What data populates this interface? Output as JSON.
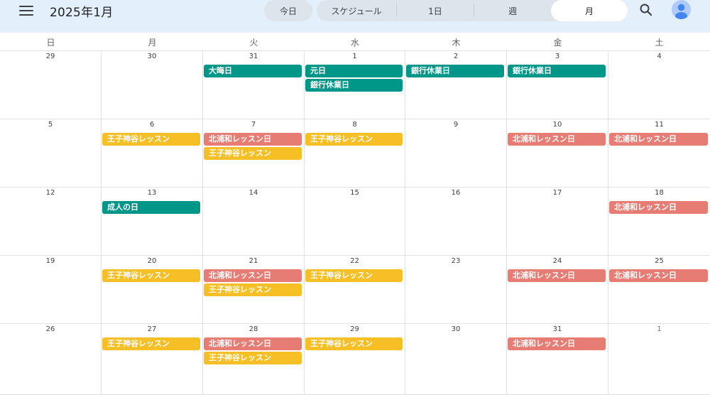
{
  "header": {
    "title": "2025年1月",
    "today_label": "今日",
    "views": [
      {
        "label": "スケジュール",
        "active": false
      },
      {
        "label": "1日",
        "active": false
      },
      {
        "label": "週",
        "active": false
      },
      {
        "label": "月",
        "active": true
      }
    ],
    "icons": {
      "menu": "hamburger-menu-icon",
      "search": "search-icon",
      "avatar": "account-avatar-icon"
    }
  },
  "weekdays": [
    "日",
    "月",
    "火",
    "水",
    "木",
    "金",
    "土"
  ],
  "colors": {
    "holiday": "#009688",
    "lesson_kamiya": "#f6bf26",
    "lesson_kitaurawa": "#e67c73",
    "topbar": "#e3effa"
  },
  "weeks": [
    [
      {
        "day": "29",
        "other": false,
        "events": []
      },
      {
        "day": "30",
        "other": false,
        "events": []
      },
      {
        "day": "31",
        "other": false,
        "events": [
          {
            "title": "大晦日",
            "type": "holiday"
          }
        ]
      },
      {
        "day": "1",
        "other": false,
        "events": [
          {
            "title": "元日",
            "type": "holiday"
          },
          {
            "title": "銀行休業日",
            "type": "holiday"
          }
        ]
      },
      {
        "day": "2",
        "other": false,
        "events": [
          {
            "title": "銀行休業日",
            "type": "holiday"
          }
        ]
      },
      {
        "day": "3",
        "other": false,
        "events": [
          {
            "title": "銀行休業日",
            "type": "holiday"
          }
        ]
      },
      {
        "day": "4",
        "other": false,
        "events": []
      }
    ],
    [
      {
        "day": "5",
        "other": false,
        "events": []
      },
      {
        "day": "6",
        "other": false,
        "events": [
          {
            "title": "王子神谷レッスン",
            "type": "lesson_kamiya"
          }
        ]
      },
      {
        "day": "7",
        "other": false,
        "events": [
          {
            "title": "北浦和レッスン日",
            "type": "lesson_kitaurawa"
          },
          {
            "title": "王子神谷レッスン",
            "type": "lesson_kamiya"
          }
        ]
      },
      {
        "day": "8",
        "other": false,
        "events": [
          {
            "title": "王子神谷レッスン",
            "type": "lesson_kamiya"
          }
        ]
      },
      {
        "day": "9",
        "other": false,
        "events": []
      },
      {
        "day": "10",
        "other": false,
        "events": [
          {
            "title": "北浦和レッスン日",
            "type": "lesson_kitaurawa"
          }
        ]
      },
      {
        "day": "11",
        "other": false,
        "events": [
          {
            "title": "北浦和レッスン日",
            "type": "lesson_kitaurawa"
          }
        ]
      }
    ],
    [
      {
        "day": "12",
        "other": false,
        "events": []
      },
      {
        "day": "13",
        "other": false,
        "events": [
          {
            "title": "成人の日",
            "type": "holiday"
          }
        ]
      },
      {
        "day": "14",
        "other": false,
        "events": []
      },
      {
        "day": "15",
        "other": false,
        "events": []
      },
      {
        "day": "16",
        "other": false,
        "events": []
      },
      {
        "day": "17",
        "other": false,
        "events": []
      },
      {
        "day": "18",
        "other": false,
        "events": [
          {
            "title": "北浦和レッスン日",
            "type": "lesson_kitaurawa"
          }
        ]
      }
    ],
    [
      {
        "day": "19",
        "other": false,
        "events": []
      },
      {
        "day": "20",
        "other": false,
        "events": [
          {
            "title": "王子神谷レッスン",
            "type": "lesson_kamiya"
          }
        ]
      },
      {
        "day": "21",
        "other": false,
        "events": [
          {
            "title": "北浦和レッスン日",
            "type": "lesson_kitaurawa"
          },
          {
            "title": "王子神谷レッスン",
            "type": "lesson_kamiya"
          }
        ]
      },
      {
        "day": "22",
        "other": false,
        "events": [
          {
            "title": "王子神谷レッスン",
            "type": "lesson_kamiya"
          }
        ]
      },
      {
        "day": "23",
        "other": false,
        "events": []
      },
      {
        "day": "24",
        "other": false,
        "events": [
          {
            "title": "北浦和レッスン日",
            "type": "lesson_kitaurawa"
          }
        ]
      },
      {
        "day": "25",
        "other": false,
        "events": [
          {
            "title": "北浦和レッスン日",
            "type": "lesson_kitaurawa"
          }
        ]
      }
    ],
    [
      {
        "day": "26",
        "other": false,
        "events": []
      },
      {
        "day": "27",
        "other": false,
        "events": [
          {
            "title": "王子神谷レッスン",
            "type": "lesson_kamiya"
          }
        ]
      },
      {
        "day": "28",
        "other": false,
        "events": [
          {
            "title": "北浦和レッスン日",
            "type": "lesson_kitaurawa"
          },
          {
            "title": "王子神谷レッスン",
            "type": "lesson_kamiya"
          }
        ]
      },
      {
        "day": "29",
        "other": false,
        "events": [
          {
            "title": "王子神谷レッスン",
            "type": "lesson_kamiya"
          }
        ]
      },
      {
        "day": "30",
        "other": false,
        "events": []
      },
      {
        "day": "31",
        "other": false,
        "events": [
          {
            "title": "北浦和レッスン日",
            "type": "lesson_kitaurawa"
          }
        ]
      },
      {
        "day": "1",
        "other": true,
        "events": []
      }
    ]
  ]
}
